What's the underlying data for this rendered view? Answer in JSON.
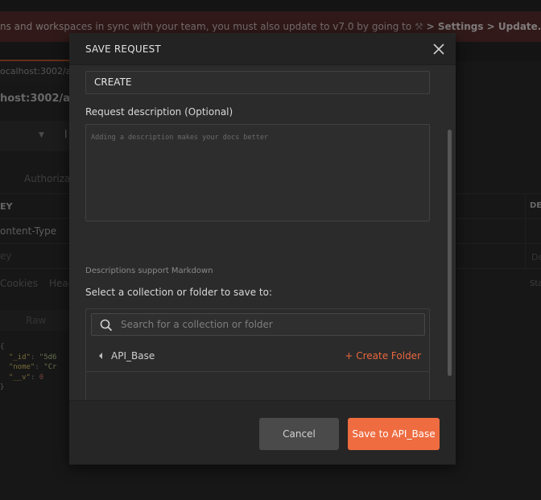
{
  "background": {
    "banner_text": "ns and workspaces in sync with your team, you must also update to v7.0 by going to",
    "banner_path": "> Settings > Update.",
    "tab_url": "ocalhost:3002/api/",
    "request_url": "host:3002/api/",
    "method_fragment": "l",
    "auth_tab": "Authorizat",
    "headers_key_col": "EY",
    "headers_row1_key": "ontent-Type",
    "headers_row2_key": "ey",
    "right_col_header": "DE",
    "right_col_placeholder": "De",
    "response_tabs": [
      "Cookies",
      "Head"
    ],
    "status_fragment": "Sta",
    "raw_tab": "Raw",
    "json_lines": [
      "{",
      "  \"_id\": \"5d6",
      "  \"nome\": \"Cr",
      "  \"__v\": 0",
      "}"
    ]
  },
  "modal": {
    "title": "SAVE REQUEST",
    "close_icon": "close-icon",
    "name_value": "CREATE",
    "description_label": "Request description (Optional)",
    "description_placeholder": "Adding a description makes your docs better",
    "markdown_note": "Descriptions support Markdown",
    "collection_label": "Select a collection or folder to save to:",
    "search_placeholder": "Search for a collection or folder",
    "collections": [
      {
        "name": "API_Base",
        "action": "+ Create Folder"
      }
    ],
    "cancel_label": "Cancel",
    "save_label": "Save to API_Base"
  },
  "colors": {
    "accent": "#ee6c40",
    "banner_bg": "#5a2e2e",
    "modal_bg": "#2b2b2b"
  }
}
